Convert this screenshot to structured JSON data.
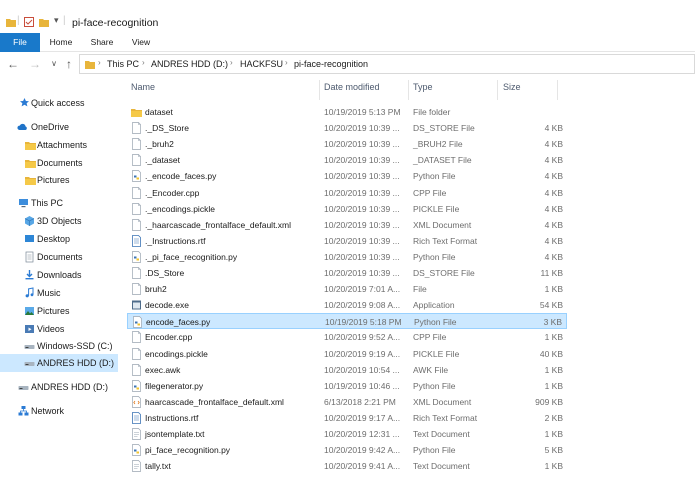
{
  "window": {
    "title": "pi-face-recognition"
  },
  "ribbon": {
    "tabs": [
      "File",
      "Home",
      "Share",
      "View"
    ]
  },
  "address": {
    "crumbs": [
      "This PC",
      "ANDRES HDD (D:)",
      "HACKFSU",
      "pi-face-recognition"
    ]
  },
  "sidebar": {
    "items": [
      {
        "label": "Quick access",
        "icon": "star-icon"
      },
      {
        "label": "OneDrive",
        "icon": "cloud-icon"
      },
      {
        "label": "Attachments",
        "icon": "folder-icon"
      },
      {
        "label": "Documents",
        "icon": "folder-icon"
      },
      {
        "label": "Pictures",
        "icon": "folder-icon"
      },
      {
        "label": "This PC",
        "icon": "computer-icon"
      },
      {
        "label": "3D Objects",
        "icon": "cube-icon"
      },
      {
        "label": "Desktop",
        "icon": "desktop-icon"
      },
      {
        "label": "Documents",
        "icon": "documents-icon"
      },
      {
        "label": "Downloads",
        "icon": "download-icon"
      },
      {
        "label": "Music",
        "icon": "music-icon"
      },
      {
        "label": "Pictures",
        "icon": "pictures-icon"
      },
      {
        "label": "Videos",
        "icon": "video-icon"
      },
      {
        "label": "Windows-SSD (C:)",
        "icon": "drive-icon"
      },
      {
        "label": "ANDRES HDD (D:)",
        "icon": "drive-icon",
        "selected": true
      },
      {
        "label": "ANDRES HDD (D:)",
        "icon": "drive-icon"
      },
      {
        "label": "Network",
        "icon": "network-icon"
      }
    ]
  },
  "columns": {
    "name": "Name",
    "date": "Date modified",
    "type": "Type",
    "size": "Size"
  },
  "files": [
    {
      "name": "dataset",
      "date": "10/19/2019 5:13 PM",
      "type": "File folder",
      "size": "",
      "icon": "folder-icon"
    },
    {
      "name": "._DS_Store",
      "date": "10/20/2019 10:39 ...",
      "type": "DS_STORE File",
      "size": "4 KB",
      "icon": "file-icon"
    },
    {
      "name": "._bruh2",
      "date": "10/20/2019 10:39 ...",
      "type": "_BRUH2 File",
      "size": "4 KB",
      "icon": "file-icon"
    },
    {
      "name": "._dataset",
      "date": "10/20/2019 10:39 ...",
      "type": "_DATASET File",
      "size": "4 KB",
      "icon": "file-icon"
    },
    {
      "name": "._encode_faces.py",
      "date": "10/20/2019 10:39 ...",
      "type": "Python File",
      "size": "4 KB",
      "icon": "python-icon"
    },
    {
      "name": "._Encoder.cpp",
      "date": "10/20/2019 10:39 ...",
      "type": "CPP File",
      "size": "4 KB",
      "icon": "file-icon"
    },
    {
      "name": "._encodings.pickle",
      "date": "10/20/2019 10:39 ...",
      "type": "PICKLE File",
      "size": "4 KB",
      "icon": "file-icon"
    },
    {
      "name": "._haarcascade_frontalface_default.xml",
      "date": "10/20/2019 10:39 ...",
      "type": "XML Document",
      "size": "4 KB",
      "icon": "file-icon"
    },
    {
      "name": "._Instructions.rtf",
      "date": "10/20/2019 10:39 ...",
      "type": "Rich Text Format",
      "size": "4 KB",
      "icon": "rtf-icon"
    },
    {
      "name": "._pi_face_recognition.py",
      "date": "10/20/2019 10:39 ...",
      "type": "Python File",
      "size": "4 KB",
      "icon": "python-icon"
    },
    {
      "name": ".DS_Store",
      "date": "10/20/2019 10:39 ...",
      "type": "DS_STORE File",
      "size": "11 KB",
      "icon": "file-icon"
    },
    {
      "name": "bruh2",
      "date": "10/20/2019 7:01 A...",
      "type": "File",
      "size": "1 KB",
      "icon": "file-icon"
    },
    {
      "name": "decode.exe",
      "date": "10/20/2019 9:08 A...",
      "type": "Application",
      "size": "54 KB",
      "icon": "exe-icon"
    },
    {
      "name": "encode_faces.py",
      "date": "10/19/2019 5:18 PM",
      "type": "Python File",
      "size": "3 KB",
      "icon": "python-icon",
      "selected": true
    },
    {
      "name": "Encoder.cpp",
      "date": "10/20/2019 9:52 A...",
      "type": "CPP File",
      "size": "1 KB",
      "icon": "file-icon"
    },
    {
      "name": "encodings.pickle",
      "date": "10/20/2019 9:19 A...",
      "type": "PICKLE File",
      "size": "40 KB",
      "icon": "file-icon"
    },
    {
      "name": "exec.awk",
      "date": "10/20/2019 10:54 ...",
      "type": "AWK File",
      "size": "1 KB",
      "icon": "file-icon"
    },
    {
      "name": "filegenerator.py",
      "date": "10/19/2019 10:46 ...",
      "type": "Python File",
      "size": "1 KB",
      "icon": "python-icon"
    },
    {
      "name": "haarcascade_frontalface_default.xml",
      "date": "6/13/2018 2:21 PM",
      "type": "XML Document",
      "size": "909 KB",
      "icon": "xml-icon"
    },
    {
      "name": "Instructions.rtf",
      "date": "10/20/2019 9:17 A...",
      "type": "Rich Text Format",
      "size": "2 KB",
      "icon": "rtf-icon"
    },
    {
      "name": "jsontemplate.txt",
      "date": "10/20/2019 12:31 ...",
      "type": "Text Document",
      "size": "1 KB",
      "icon": "txt-icon"
    },
    {
      "name": "pi_face_recognition.py",
      "date": "10/20/2019 9:42 A...",
      "type": "Python File",
      "size": "5 KB",
      "icon": "python-icon"
    },
    {
      "name": "tally.txt",
      "date": "10/20/2019 9:41 A...",
      "type": "Text Document",
      "size": "1 KB",
      "icon": "txt-icon"
    }
  ]
}
